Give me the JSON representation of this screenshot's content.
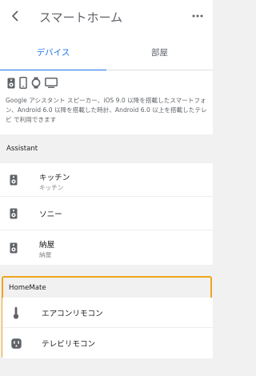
{
  "appbar": {
    "title": "スマートホーム",
    "back_icon": "arrow-back-icon",
    "more_icon": "more-horiz-icon"
  },
  "tabs": [
    {
      "label": "デバイス",
      "active": true
    },
    {
      "label": "部屋",
      "active": false
    }
  ],
  "devices_info": {
    "icons": [
      "speaker-icon",
      "phone-icon",
      "watch-icon",
      "tv-icon"
    ],
    "text": "Google アシスタント スピーカー、iOS 9.0 以降を搭載したスマートフォン、Android 6.0 以降を搭載した時計、Android 6.0 以上を搭載したテレビ で利用できます"
  },
  "assistant": {
    "header": "Assistant",
    "items": [
      {
        "label": "キッチン",
        "sub": "キッチン",
        "icon": "speaker-icon"
      },
      {
        "label": "ソニー",
        "sub": "",
        "icon": "speaker-icon"
      },
      {
        "label": "納屋",
        "sub": "納屋",
        "icon": "speaker-icon"
      }
    ]
  },
  "homemate": {
    "header": "HomeMate",
    "items": [
      {
        "label": "エアコンリモコン",
        "icon": "thermometer-icon"
      },
      {
        "label": "テレビリモコン",
        "icon": "outlet-icon"
      }
    ]
  },
  "colors": {
    "accent": "#1a73e8",
    "highlight": "#f0a41c"
  }
}
